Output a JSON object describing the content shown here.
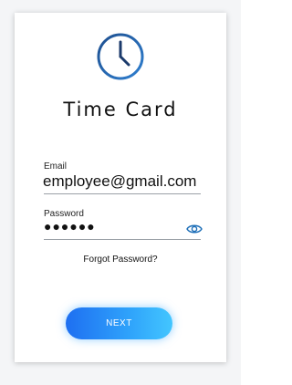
{
  "app": {
    "title": "Time Card",
    "logo_icon": "clock-icon"
  },
  "form": {
    "email": {
      "label": "Email",
      "value": "employee@gmail.com"
    },
    "password": {
      "label": "Password",
      "value": "●●●●●●",
      "toggle_icon": "eye-icon"
    },
    "forgot_label": "Forgot Password?",
    "next_label": "NEXT"
  },
  "colors": {
    "accent": "#2a8ff7",
    "accent_light": "#43c6ff",
    "logo_dark": "#1b3a6b"
  }
}
